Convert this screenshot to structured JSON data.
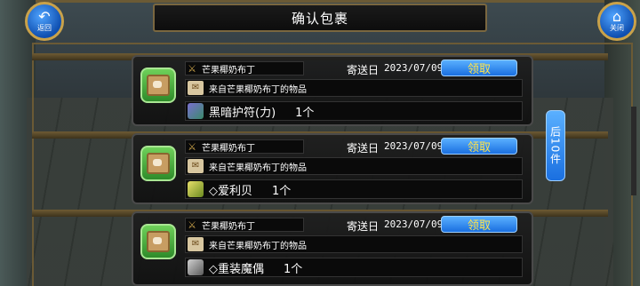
{
  "header": {
    "title": "确认包裹",
    "back_label": "返回",
    "close_label": "关闭"
  },
  "pager": {
    "next_label": "后10件"
  },
  "packages": [
    {
      "sender": "芒果椰奶布丁",
      "date_label": "寄送日",
      "date": "2023/07/09",
      "claim_label": "领取",
      "message": "来自芒果椰奶布丁的物品",
      "item_name": "黑暗护符(力)",
      "item_qty": "1个",
      "item_icon": "dark-amulet-icon"
    },
    {
      "sender": "芒果椰奶布丁",
      "date_label": "寄送日",
      "date": "2023/07/09",
      "claim_label": "领取",
      "message": "来自芒果椰奶布丁的物品",
      "item_name": "◇爱利贝",
      "item_qty": "1个",
      "item_icon": "feather-icon"
    },
    {
      "sender": "芒果椰奶布丁",
      "date_label": "寄送日",
      "date": "2023/07/09",
      "claim_label": "领取",
      "message": "来自芒果椰奶布丁的物品",
      "item_name": "◇重装魔偶",
      "item_qty": "1个",
      "item_icon": "golem-claw-icon"
    }
  ],
  "colors": {
    "accent_blue": "#1a6fe0",
    "claim_text": "#ffe44a",
    "frame_gold": "#6b5a35",
    "package_green": "#2e8b2a"
  }
}
